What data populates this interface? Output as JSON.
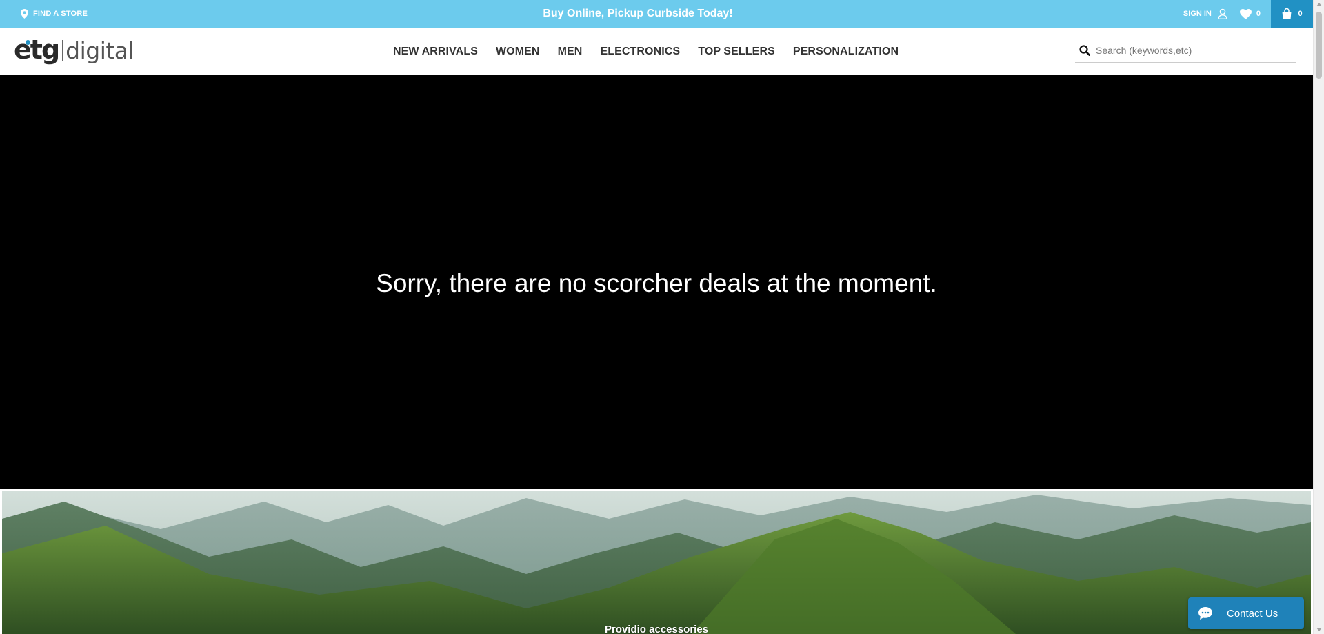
{
  "topbar": {
    "find_store_label": "FIND A STORE",
    "find_store_icon": "map-pin-icon",
    "promo_text": "Buy Online, Pickup Curbside Today!",
    "signin_label": "SIGN IN",
    "signin_icon": "user-icon",
    "wishlist_count": "0",
    "wishlist_icon": "heart-icon",
    "cart_count": "0",
    "cart_icon": "shopping-bag-icon",
    "bar_color": "#6ccbed",
    "cart_color": "#2191c4"
  },
  "header": {
    "logo_primary": "etg",
    "logo_secondary": "digital",
    "nav": [
      {
        "label": "NEW ARRIVALS"
      },
      {
        "label": "WOMEN"
      },
      {
        "label": "MEN"
      },
      {
        "label": "ELECTRONICS"
      },
      {
        "label": "TOP SELLERS"
      },
      {
        "label": "PERSONALIZATION"
      }
    ],
    "search": {
      "placeholder": "Search (keywords,etc)",
      "value": "",
      "icon": "search-icon"
    }
  },
  "hero": {
    "message": "Sorry, there are no scorcher deals at the moment.",
    "background": "#000000"
  },
  "banner": {
    "caption": "Providio accessories"
  },
  "contact_widget": {
    "label": "Contact Us",
    "icon": "chat-bubble-icon",
    "color": "#1f82b9"
  }
}
